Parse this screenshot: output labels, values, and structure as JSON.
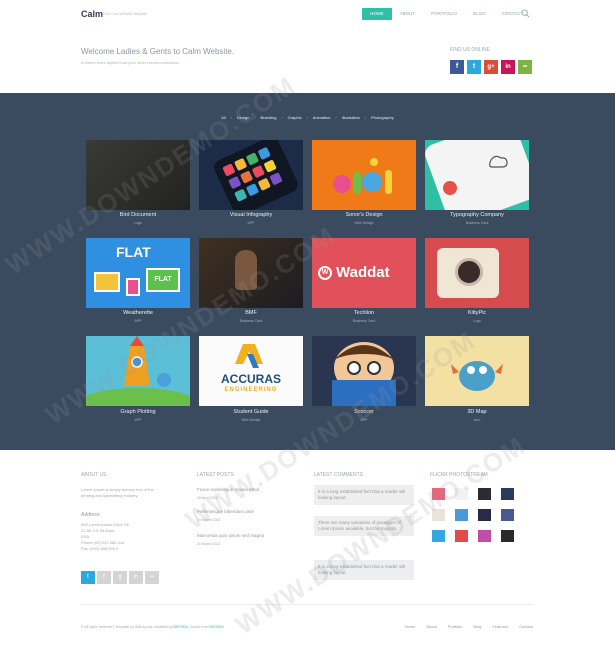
{
  "header": {
    "logo": "Calm",
    "tagline": "Free Cool Website Template",
    "nav": [
      "Home",
      "About",
      "Portfolio",
      "Blog",
      "Contact"
    ],
    "active_nav": "Home"
  },
  "intro": {
    "title": "Welcome Ladies & Gents to Calm Website.",
    "subtitle": "A theme more stylish than your other recommendations"
  },
  "follow": {
    "title": "Find us online",
    "icons": [
      {
        "name": "facebook-icon",
        "glyph": "f",
        "color": "#3b5998"
      },
      {
        "name": "twitter-icon",
        "glyph": "t",
        "color": "#2aa9e0"
      },
      {
        "name": "googleplus-icon",
        "glyph": "g+",
        "color": "#dd4b39"
      },
      {
        "name": "linkedin-icon",
        "glyph": "in",
        "color": "#c2185b"
      },
      {
        "name": "flickr-icon",
        "glyph": "••",
        "color": "#7cb342"
      }
    ]
  },
  "filters": [
    "All",
    "Design",
    "Branding",
    "Graphic",
    "Animation",
    "Illustration",
    "Photography"
  ],
  "portfolio": [
    {
      "title": "Bird Document",
      "category": "Logo"
    },
    {
      "title": "Visual Infography",
      "category": "APP"
    },
    {
      "title": "Sonor's Design",
      "category": "Web Design"
    },
    {
      "title": "Typography Company",
      "category": "Business Card"
    },
    {
      "title": "Weatherette",
      "category": "APP"
    },
    {
      "title": "BMF",
      "category": "Business Card"
    },
    {
      "title": "Techlion",
      "category": "Business Card"
    },
    {
      "title": "KittyPic",
      "category": "Logo"
    },
    {
      "title": "Graph Plotting",
      "category": "APP"
    },
    {
      "title": "Student Guide",
      "category": "Web Design"
    },
    {
      "title": "Scoccer",
      "category": "APP"
    },
    {
      "title": "3D Map",
      "category": "Icon"
    }
  ],
  "tile_text": {
    "flat1": "FLAT",
    "flat2": "FLAT",
    "waddat": "Waddat",
    "accuras": "ACCURAS",
    "engineering": "ENGINEERING"
  },
  "about": {
    "heading": "About us",
    "text1": "Lorem Ipsum is simply dummy text of the",
    "text2": "printing and typesetting industry.",
    "address_heading": "Address:",
    "address": [
      "500 Lorem Ipsum Dolor Sit",
      "22-56-2-9 Sit Amet,",
      "USA",
      "Phone:(00) 222 666 444",
      "Fax: (000) 888 999 0"
    ]
  },
  "latest_posts": {
    "heading": "Latest posts",
    "items": [
      {
        "title": "Fusce scelerisque massa ettod",
        "date": "26 April 2013"
      },
      {
        "title": "Pellentesque bibendum ante",
        "date": "19 March 2013"
      },
      {
        "title": "Maecenas quis ipsum sed magna",
        "date": "20 March 2013"
      }
    ]
  },
  "latest_comments": {
    "heading": "Latest comments",
    "items": [
      "It is a long established fact that a reader will looking layout.",
      "There are many variations of passages of Lorem Ipsum available, but the majority.",
      "It is a long established fact that a reader will looking layout."
    ]
  },
  "flickr": {
    "heading": "Flickr photostream",
    "colors": [
      "#e8667c",
      "#f2f2f2",
      "#2b2b35",
      "#2b3a58",
      "#e9e3d8",
      "#4a9ad9",
      "#2a2a44",
      "#4a5890",
      "#33a7e0",
      "#e24a4a",
      "#c04da6",
      "#2a2a2a"
    ]
  },
  "footer_social": [
    {
      "name": "twitter-icon",
      "glyph": "t",
      "color": "#2aa9e0"
    },
    {
      "name": "facebook-icon",
      "glyph": "f",
      "color": "#d4d4d4"
    },
    {
      "name": "googleplus-icon",
      "glyph": "g",
      "color": "#d4d4d4"
    },
    {
      "name": "linkedin-icon",
      "glyph": "in",
      "color": "#d4d4d4"
    },
    {
      "name": "flickr-icon",
      "glyph": "••",
      "color": "#d4d4d4"
    }
  ],
  "footer": {
    "copyright": "© All rights reserved | Template by W3Layouts. Modified by",
    "brand1": "BECREA",
    "mid": ". Collect from",
    "brand2": "BECREA",
    "nav": [
      "Home",
      "About",
      "Portfolio",
      "Blog",
      "Features",
      "Contact"
    ]
  },
  "watermark": "WWW.DOWNDEMO.COM"
}
